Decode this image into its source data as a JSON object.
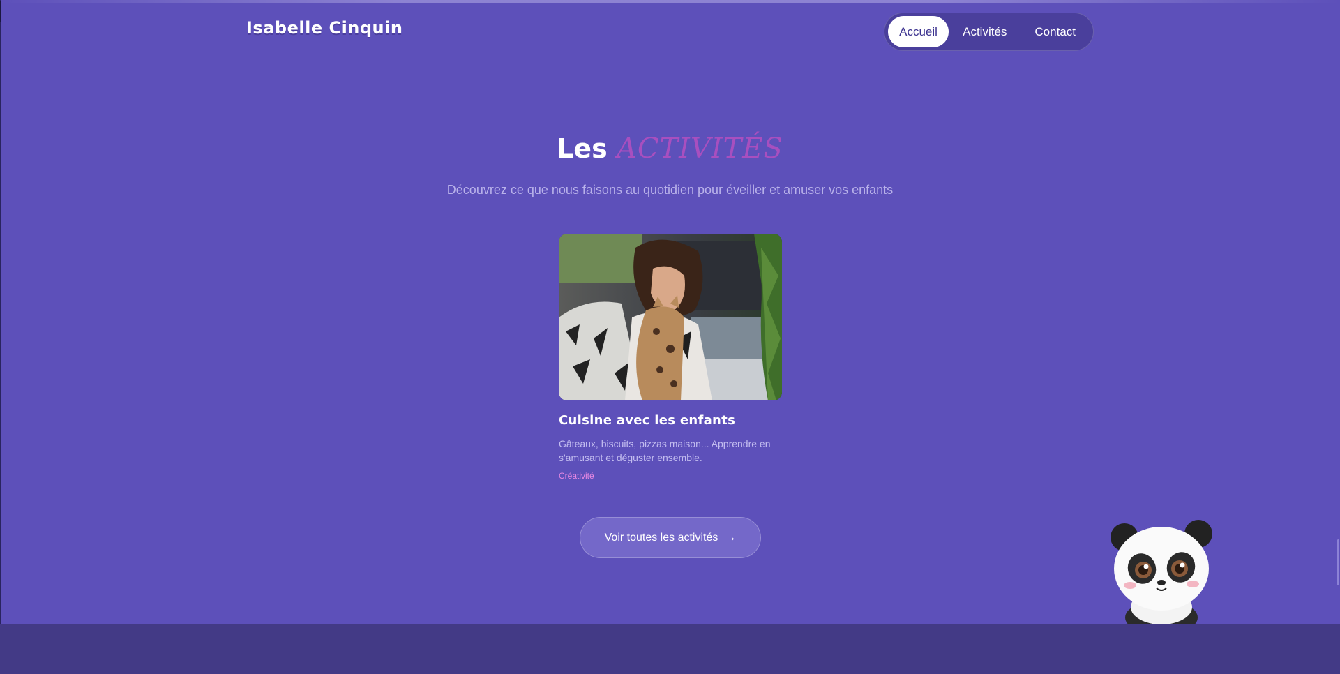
{
  "header": {
    "brand": "Isabelle Cinquin",
    "nav": [
      {
        "label": "Accueil",
        "active": true
      },
      {
        "label": "Activités",
        "active": false
      },
      {
        "label": "Contact",
        "active": false
      }
    ]
  },
  "section": {
    "title_prefix": "Les",
    "title_accent": "ACTIVITÉS",
    "subtitle": "Découvrez ce que nous faisons au quotidien pour éveiller et amuser vos enfants"
  },
  "card": {
    "title": "Cuisine avec les enfants",
    "description": "Gâteaux, biscuits, pizzas maison... Apprendre en s'amusant et déguster ensemble.",
    "tag": "Créativité"
  },
  "cta": {
    "label": "Voir toutes les activités",
    "icon": "arrow-right-icon"
  },
  "colors": {
    "background": "#5d50ba",
    "accent": "#a84fbf",
    "tag": "#e889e3",
    "footer": "#433a86"
  }
}
